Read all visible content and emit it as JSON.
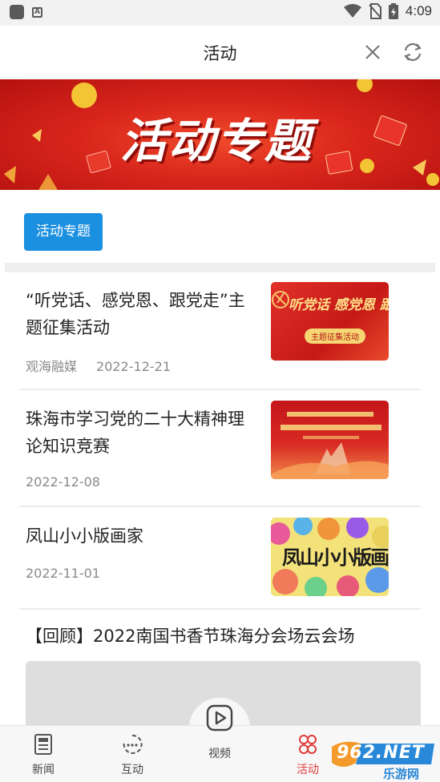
{
  "status_bar": {
    "time": "4:09"
  },
  "header": {
    "title": "活动"
  },
  "banner": {
    "text": "活动专题"
  },
  "tag": {
    "label": "活动专题"
  },
  "articles": [
    {
      "title": "“听党话、感党恩、跟党走”主题征集活动",
      "source": "观海融媒",
      "date": "2022-12-21",
      "thumb_text": "听党话 感党恩 跟党走",
      "thumb_sub": "主题征集活动"
    },
    {
      "title": "珠海市学习党的二十大精神理论知识竞赛",
      "source": "",
      "date": "2022-12-08"
    },
    {
      "title": "凤山小小版画家",
      "source": "",
      "date": "2022-11-01",
      "thumb_text": "凤山小小版画家"
    }
  ],
  "review": {
    "title": "【回顾】2022南国书香节珠海分会场云会场"
  },
  "bottom_nav": [
    {
      "label": "新闻",
      "icon": "newspaper-icon"
    },
    {
      "label": "互动",
      "icon": "interaction-icon"
    },
    {
      "label": "视频",
      "icon": "play-icon"
    },
    {
      "label": "活动",
      "icon": "activity-icon",
      "active": true
    }
  ],
  "watermark": {
    "text": "962.NET",
    "sub": "乐游网"
  },
  "colors": {
    "accent_blue": "#1b8fe0",
    "active_red": "#e03a3a",
    "banner_red": "#d9261c"
  }
}
